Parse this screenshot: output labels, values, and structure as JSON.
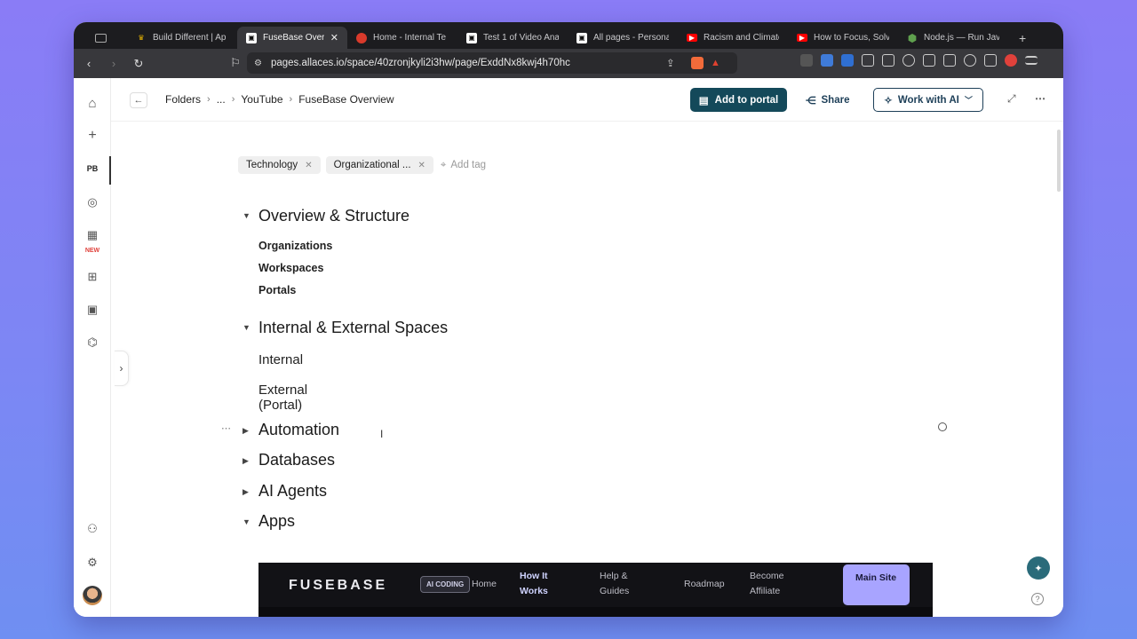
{
  "browser": {
    "tabs": [
      {
        "title": "",
        "favicon": "window-icon",
        "color": "#555555"
      },
      {
        "title": "Build Different | Ap",
        "favicon": "crown-icon",
        "color": "#e8b400"
      },
      {
        "title": "FuseBase Over",
        "favicon": "fusebase-icon",
        "color": "#ffffff",
        "active": true
      },
      {
        "title": "Home - Internal Te",
        "favicon": "red-circle-icon",
        "color": "#d93a2b"
      },
      {
        "title": "Test 1 of Video Ana",
        "favicon": "fusebase-icon",
        "color": "#ffffff"
      },
      {
        "title": "All pages - Persona",
        "favicon": "fusebase-icon",
        "color": "#ffffff"
      },
      {
        "title": "Racism and Climate",
        "favicon": "youtube-icon",
        "color": "#ff0000"
      },
      {
        "title": "How to Focus, Solv",
        "favicon": "youtube-icon",
        "color": "#ff0000"
      },
      {
        "title": "Node.js — Run Java",
        "favicon": "nodejs-icon",
        "color": "#5fa04e"
      }
    ],
    "new_tab": "+",
    "url": "pages.allaces.io/space/40zronjkyli2i3hw/page/ExddNx8kwj4h70hc"
  },
  "app": {
    "breadcrumb": {
      "items": [
        "Folders",
        "...",
        "YouTube",
        "FuseBase Overview"
      ],
      "separator": "›"
    },
    "header": {
      "add_to_portal": "Add to portal",
      "share": "Share",
      "work_with_ai": "Work with AI"
    },
    "rail": {
      "workspace_badge": "PB",
      "new_label": "NEW"
    },
    "tags": [
      "Technology",
      "Organizational ..."
    ],
    "add_tag": "Add tag",
    "sections": [
      {
        "title": "Overview & Structure",
        "expanded": true,
        "items": [
          "Organizations",
          "Workspaces",
          "Portals"
        ]
      },
      {
        "title": "Internal & External Spaces",
        "expanded": true,
        "items": [
          "Internal",
          "External (Portal)"
        ]
      },
      {
        "title": "Automation",
        "expanded": false
      },
      {
        "title": "Databases",
        "expanded": false
      },
      {
        "title": "AI Agents",
        "expanded": false
      },
      {
        "title": "Apps",
        "expanded": true
      }
    ],
    "embed": {
      "logo": "FUSEBASE",
      "badge": "AI CODING",
      "nav": [
        "Home",
        "How It Works",
        "Help & Guides",
        "Roadmap",
        "Become Affiliate"
      ],
      "cta": "Main Site"
    }
  }
}
